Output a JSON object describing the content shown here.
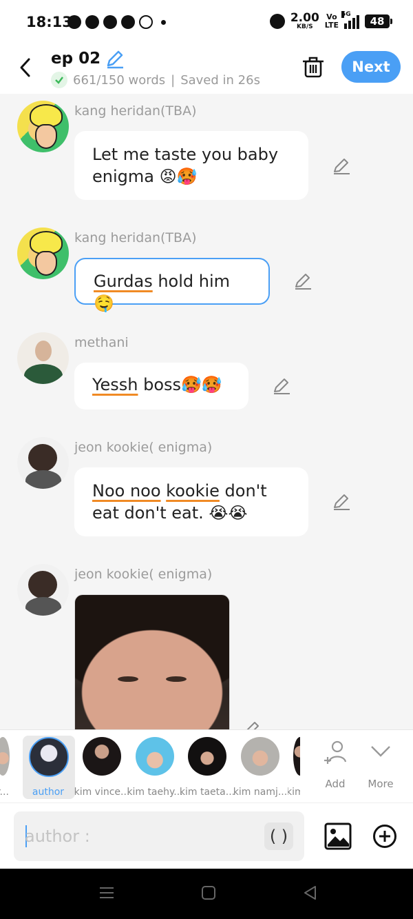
{
  "status_bar": {
    "time": "18:13",
    "speed_value": "2.00",
    "speed_unit": "KB/S",
    "volte": "Vo\nLTE",
    "network": "5G",
    "battery": "48"
  },
  "header": {
    "title": "ep 02",
    "word_count": "661/150 words",
    "separator": "|",
    "saved": "Saved in 26s",
    "next_label": "Next"
  },
  "messages": [
    {
      "author": "kang heridan(TBA)",
      "text": "Let me taste you baby enigma 😡🥵"
    },
    {
      "author": "kang heridan(TBA)",
      "underlined": "Gurdas",
      "rest": " hold him 🤤"
    },
    {
      "author": "methani",
      "underlined": "Yessh",
      "rest": " boss🥵🥵"
    },
    {
      "author": "jeon kookie( enigma)",
      "u1": "Noo noo",
      "sp": " ",
      "u2": "kookie",
      "rest": " don't eat don't eat. 😭😭"
    },
    {
      "author": "jeon kookie( enigma)",
      "image": "photo"
    }
  ],
  "characters": [
    {
      "label": "r..."
    },
    {
      "label": "author"
    },
    {
      "label": "kim vince..."
    },
    {
      "label": "kim taehy..."
    },
    {
      "label": "kim taeta..."
    },
    {
      "label": "kim namj..."
    },
    {
      "label": "kim"
    }
  ],
  "actions": {
    "add_label": "Add",
    "more_label": "More"
  },
  "composer": {
    "placeholder": "author :",
    "paren_label": "( )"
  },
  "colors": {
    "accent": "#4a9ff5",
    "underline": "#f08a24"
  }
}
